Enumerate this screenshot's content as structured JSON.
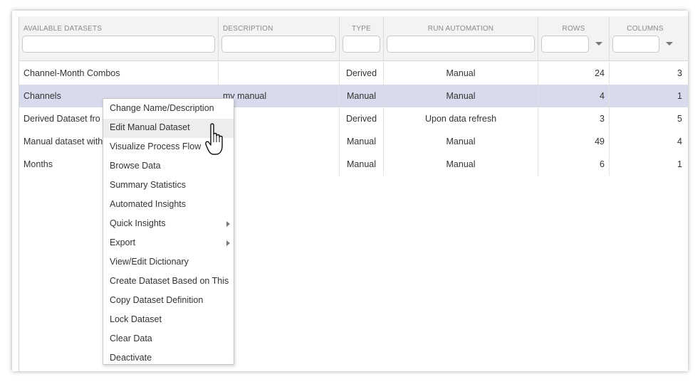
{
  "columns": [
    {
      "label": "AVAILABLE DATASETS",
      "filter": "text"
    },
    {
      "label": "DESCRIPTION",
      "filter": "text"
    },
    {
      "label": "TYPE",
      "filter": "text"
    },
    {
      "label": "RUN AUTOMATION",
      "filter": "text"
    },
    {
      "label": "ROWS",
      "filter": "select"
    },
    {
      "label": "COLUMNS",
      "filter": "select"
    }
  ],
  "rows": [
    {
      "name": "Channel-Month Combos",
      "description": "",
      "type": "Derived",
      "automation": "Manual",
      "rows": "24",
      "columns": "3"
    },
    {
      "name": "Channels",
      "description": "my manual",
      "type": "Manual",
      "automation": "Manual",
      "rows": "4",
      "columns": "1",
      "selected": true
    },
    {
      "name": "Derived Dataset fro",
      "description": "",
      "type": "Derived",
      "automation": "Upon data refresh",
      "rows": "3",
      "columns": "5"
    },
    {
      "name": "Manual dataset with",
      "description": "",
      "type": "Manual",
      "automation": "Manual",
      "rows": "49",
      "columns": "4"
    },
    {
      "name": "Months",
      "description": "",
      "type": "Manual",
      "automation": "Manual",
      "rows": "6",
      "columns": "1"
    }
  ],
  "context_menu": [
    {
      "label": "Change Name/Description"
    },
    {
      "label": "Edit Manual Dataset",
      "hover": true
    },
    {
      "label": "Visualize Process Flow"
    },
    {
      "label": "Browse Data"
    },
    {
      "label": "Summary Statistics"
    },
    {
      "label": "Automated Insights"
    },
    {
      "label": "Quick Insights",
      "submenu": true
    },
    {
      "label": "Export",
      "submenu": true
    },
    {
      "label": "View/Edit Dictionary"
    },
    {
      "label": "Create Dataset Based on This"
    },
    {
      "label": "Copy Dataset Definition"
    },
    {
      "label": "Lock Dataset"
    },
    {
      "label": "Clear Data"
    },
    {
      "label": "Deactivate"
    }
  ],
  "colors": {
    "selected_row": "#d7dbec",
    "menu_hover": "#ededed",
    "header_bg": "#f3f3f3"
  }
}
